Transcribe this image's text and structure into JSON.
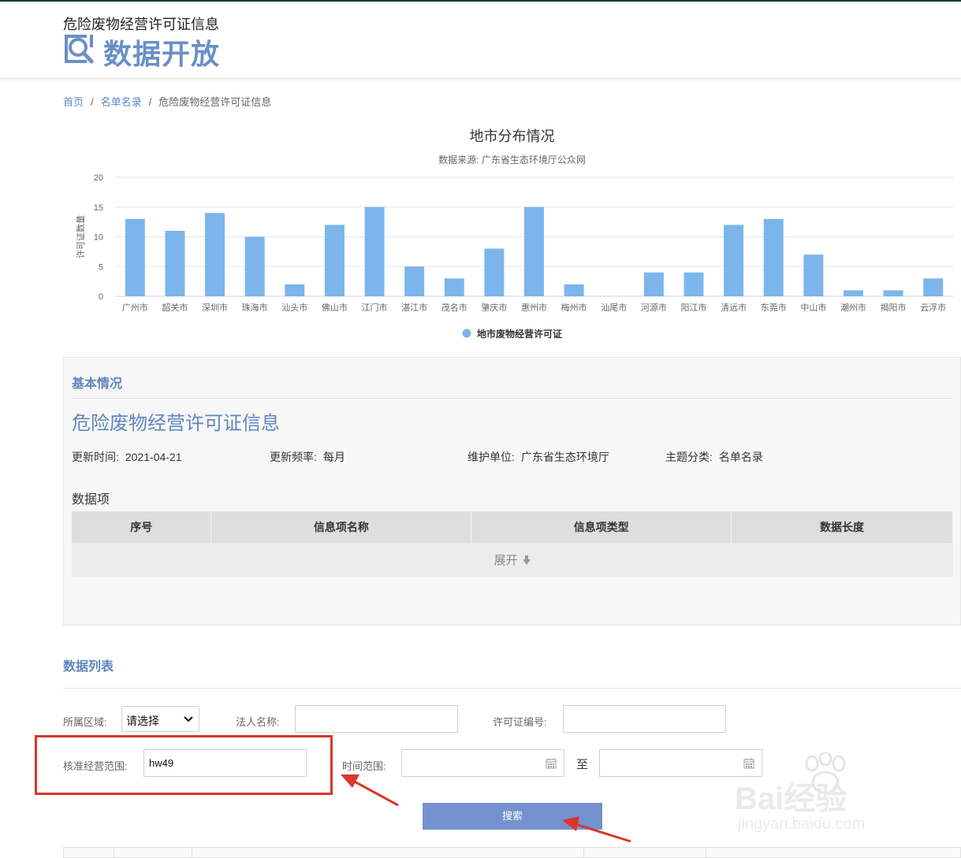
{
  "header": {
    "subtitle": "危险废物经营许可证信息",
    "title": "数据开放"
  },
  "breadcrumb": {
    "home": "首页",
    "category": "名单名录",
    "current": "危险废物经营许可证信息",
    "separator": "/"
  },
  "chart_data": {
    "type": "bar",
    "title": "地市分布情况",
    "subtitle": "数据来源: 广东省生态环境厅公众网",
    "ylabel": "许可证数量",
    "xlabel": "",
    "ylim": [
      0,
      20
    ],
    "yticks": [
      0,
      5,
      10,
      15,
      20
    ],
    "grid": true,
    "legend_position": "bottom",
    "categories": [
      "广州市",
      "韶关市",
      "深圳市",
      "珠海市",
      "汕头市",
      "佛山市",
      "江门市",
      "湛江市",
      "茂名市",
      "肇庆市",
      "惠州市",
      "梅州市",
      "汕尾市",
      "河源市",
      "阳江市",
      "清远市",
      "东莞市",
      "中山市",
      "潮州市",
      "揭阳市",
      "云浮市"
    ],
    "series": [
      {
        "name": "地市废物经营许可证",
        "color": "#7cb5ec",
        "values": [
          13,
          11,
          14,
          10,
          2,
          12,
          15,
          5,
          3,
          8,
          15,
          2,
          0,
          4,
          4,
          12,
          13,
          7,
          1,
          1,
          3
        ]
      }
    ]
  },
  "basic": {
    "section_title": "基本情况",
    "title": "危险废物经营许可证信息",
    "update_time_label": "更新时间:",
    "update_time": "2021-04-21",
    "frequency_label": "更新频率:",
    "frequency": "每月",
    "maintainer_label": "维护单位:",
    "maintainer": "广东省生态环境厅",
    "topic_label": "主题分类:",
    "topic": "名单名录",
    "items_label": "数据项",
    "table_headers": [
      "序号",
      "信息项名称",
      "信息项类型",
      "数据长度"
    ],
    "expand_label": "展开"
  },
  "list": {
    "section_title": "数据列表",
    "region_label": "所属区域:",
    "region_value": "请选择",
    "legal_label": "法人名称:",
    "legal_value": "",
    "license_label": "许可证编号:",
    "license_value": "",
    "scope_label": "核准经营范围:",
    "scope_value": "hw49",
    "time_label": "时间范围:",
    "time_start": "",
    "time_to": "至",
    "time_end": "",
    "search_label": "搜索"
  },
  "watermark": {
    "brand": "Bai经验",
    "url": "jingyan.baidu.com"
  },
  "colors": {
    "accent": "#5f86be",
    "button": "#7492cf",
    "highlight": "#d9362f",
    "bar": "#7cb5ec"
  }
}
